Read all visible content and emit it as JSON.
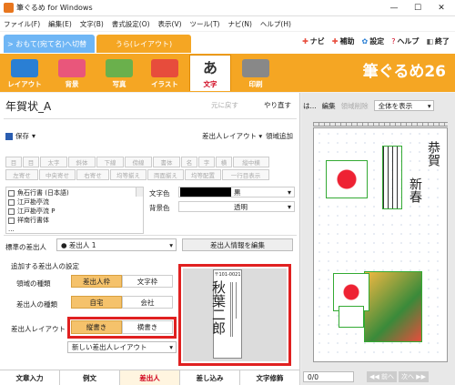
{
  "titlebar": {
    "title": "筆ぐるめ for Windows"
  },
  "menu": [
    "ファイル(F)",
    "編集(E)",
    "文字(B)",
    "書式設定(O)",
    "表示(V)",
    "ツール(T)",
    "ナビ(N)",
    "ヘルプ(H)"
  ],
  "tabs": {
    "omote": "> おもて(宛て名)へ切替",
    "ura": "うら(レイアウト)"
  },
  "toplinks": {
    "navi": "ナビ",
    "hojo": "補助",
    "settei": "設定",
    "help": "ヘルプ",
    "exit": "終了"
  },
  "ribbon": [
    {
      "label": "レイアウト",
      "color": "#2a7fd4"
    },
    {
      "label": "背景",
      "color": "#e9567b"
    },
    {
      "label": "写真",
      "color": "#6ab04c"
    },
    {
      "label": "イラスト",
      "color": "#e74c3c"
    },
    {
      "label": "文字",
      "color": "#333333"
    },
    {
      "label": "印刷",
      "color": "#888888"
    }
  ],
  "brand": "筆ぐるめ26",
  "doc": {
    "title": "年賀状_A",
    "undo": "元に戻す",
    "redo": "やり直す"
  },
  "toolbar": {
    "save": "保存",
    "sender_layout": "差出人レイアウト",
    "add_area": "領域追加"
  },
  "format_rows": [
    [
      "目",
      "目",
      "太字",
      "斜体",
      "下線",
      "傍線",
      "書体",
      "名",
      "字",
      "横",
      "縦中横"
    ],
    [
      "左寄せ",
      "中央寄せ",
      "右寄せ",
      "均等揃え",
      "両面揃え",
      "均等配置",
      "一行目表示"
    ]
  ],
  "fonts": [
    "魚石行書 (日本語)",
    "江戸勘亭流",
    "江戸勘亭流 P",
    "祥南行書体",
    "..."
  ],
  "colors": {
    "text_label": "文字色",
    "text_value": "黒",
    "bg_label": "背景色",
    "bg_value": "透明"
  },
  "sender": {
    "label": "標準の差出人",
    "value": "● 差出人 1",
    "edit": "差出人情報を編集"
  },
  "settings": {
    "heading": "追加する差出人の設定",
    "area_type": "領域の種類",
    "area_opt1": "差出人枠",
    "area_opt2": "文字枠",
    "sender_type": "差出人の種類",
    "type_opt1": "自宅",
    "type_opt2": "会社",
    "layout": "差出人レイアウト",
    "layout_opt1": "縦書き",
    "layout_opt2": "横書き",
    "new_layout": "新しい差出人レイアウト"
  },
  "card": {
    "postal": "〒101-0021",
    "name": "秋葉二郎"
  },
  "bottom_tabs": [
    "文章入力",
    "例文",
    "差出人",
    "差し込み",
    "文字修飾"
  ],
  "right": {
    "ha": "は...",
    "edit": "編集",
    "delete": "領域削除",
    "view": "全体を表示",
    "page": "0/0",
    "prev": "◀◀ 前へ",
    "next": "次へ ▶▶"
  },
  "nenga": {
    "text1": "恭賀",
    "text2": "新春"
  }
}
